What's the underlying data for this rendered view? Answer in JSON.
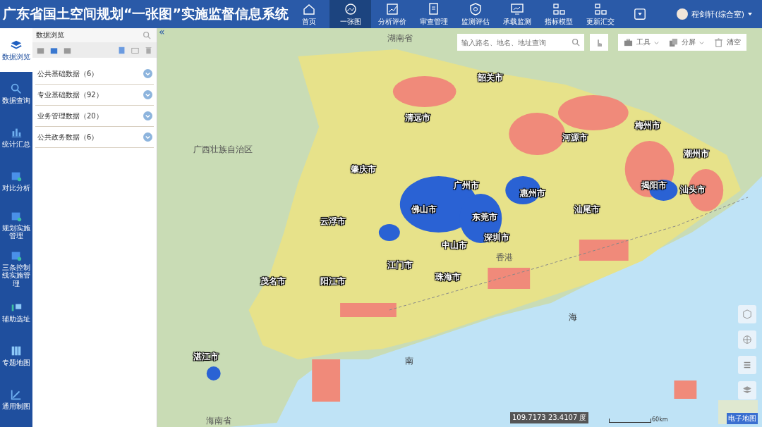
{
  "app_title": "广东省国土空间规划“一张图”实施监督信息系统",
  "nav": [
    {
      "label": "首页",
      "selected": false
    },
    {
      "label": "一张图",
      "selected": true
    },
    {
      "label": "分析评价",
      "selected": false
    },
    {
      "label": "审查管理",
      "selected": false
    },
    {
      "label": "监测评估",
      "selected": false
    },
    {
      "label": "承载监测",
      "selected": false
    },
    {
      "label": "指标模型",
      "selected": false
    },
    {
      "label": "更新汇交",
      "selected": false
    }
  ],
  "user": {
    "name": "程剑轩(综合室)"
  },
  "sidebar": [
    {
      "label": "数据浏览",
      "selected": true
    },
    {
      "label": "数据查询",
      "selected": false
    },
    {
      "label": "统计汇总",
      "selected": false
    },
    {
      "label": "对比分析",
      "selected": false
    },
    {
      "label": "规划实施管理",
      "selected": false
    },
    {
      "label": "三条控制线实施管理",
      "selected": false
    },
    {
      "label": "辅助选址",
      "selected": false
    },
    {
      "label": "专题地图",
      "selected": false
    },
    {
      "label": "通用制图",
      "selected": false
    }
  ],
  "panel": {
    "title": "数据浏览",
    "items": [
      {
        "label": "公共基础数据（6）"
      },
      {
        "label": "专业基础数据（92）"
      },
      {
        "label": "业务管理数据（20）"
      },
      {
        "label": "公共政务数据（6）"
      }
    ]
  },
  "map": {
    "collapse_toggle": "«",
    "search_placeholder": "输入路名、地名、地址查询",
    "tools": [
      {
        "label": "工具"
      },
      {
        "label": "分屏"
      },
      {
        "label": "清空"
      }
    ],
    "labels": [
      {
        "text": "湖南省",
        "kind": "region"
      },
      {
        "text": "韶关市",
        "kind": "city"
      },
      {
        "text": "清远市",
        "kind": "city"
      },
      {
        "text": "梅州市",
        "kind": "city"
      },
      {
        "text": "河源市",
        "kind": "city"
      },
      {
        "text": "广西壮族自治区",
        "kind": "region"
      },
      {
        "text": "潮州市",
        "kind": "city"
      },
      {
        "text": "肇庆市",
        "kind": "city"
      },
      {
        "text": "广州市",
        "kind": "city"
      },
      {
        "text": "揭阳市",
        "kind": "city"
      },
      {
        "text": "汕头市",
        "kind": "city"
      },
      {
        "text": "惠州市",
        "kind": "city"
      },
      {
        "text": "佛山市",
        "kind": "city"
      },
      {
        "text": "汕尾市",
        "kind": "city"
      },
      {
        "text": "东莞市",
        "kind": "city"
      },
      {
        "text": "云浮市",
        "kind": "city"
      },
      {
        "text": "深圳市",
        "kind": "city"
      },
      {
        "text": "中山市",
        "kind": "city"
      },
      {
        "text": "香港",
        "kind": "region"
      },
      {
        "text": "江门市",
        "kind": "city"
      },
      {
        "text": "珠海市",
        "kind": "city"
      },
      {
        "text": "茂名市",
        "kind": "city"
      },
      {
        "text": "阳江市",
        "kind": "city"
      },
      {
        "text": "海",
        "kind": "sea"
      },
      {
        "text": "湛江市",
        "kind": "city"
      },
      {
        "text": "南",
        "kind": "sea"
      },
      {
        "text": "海南省",
        "kind": "region"
      }
    ],
    "coordinates": "109.7173 23.4107 度",
    "scale": "60km",
    "basemap_label": "电子地图"
  }
}
